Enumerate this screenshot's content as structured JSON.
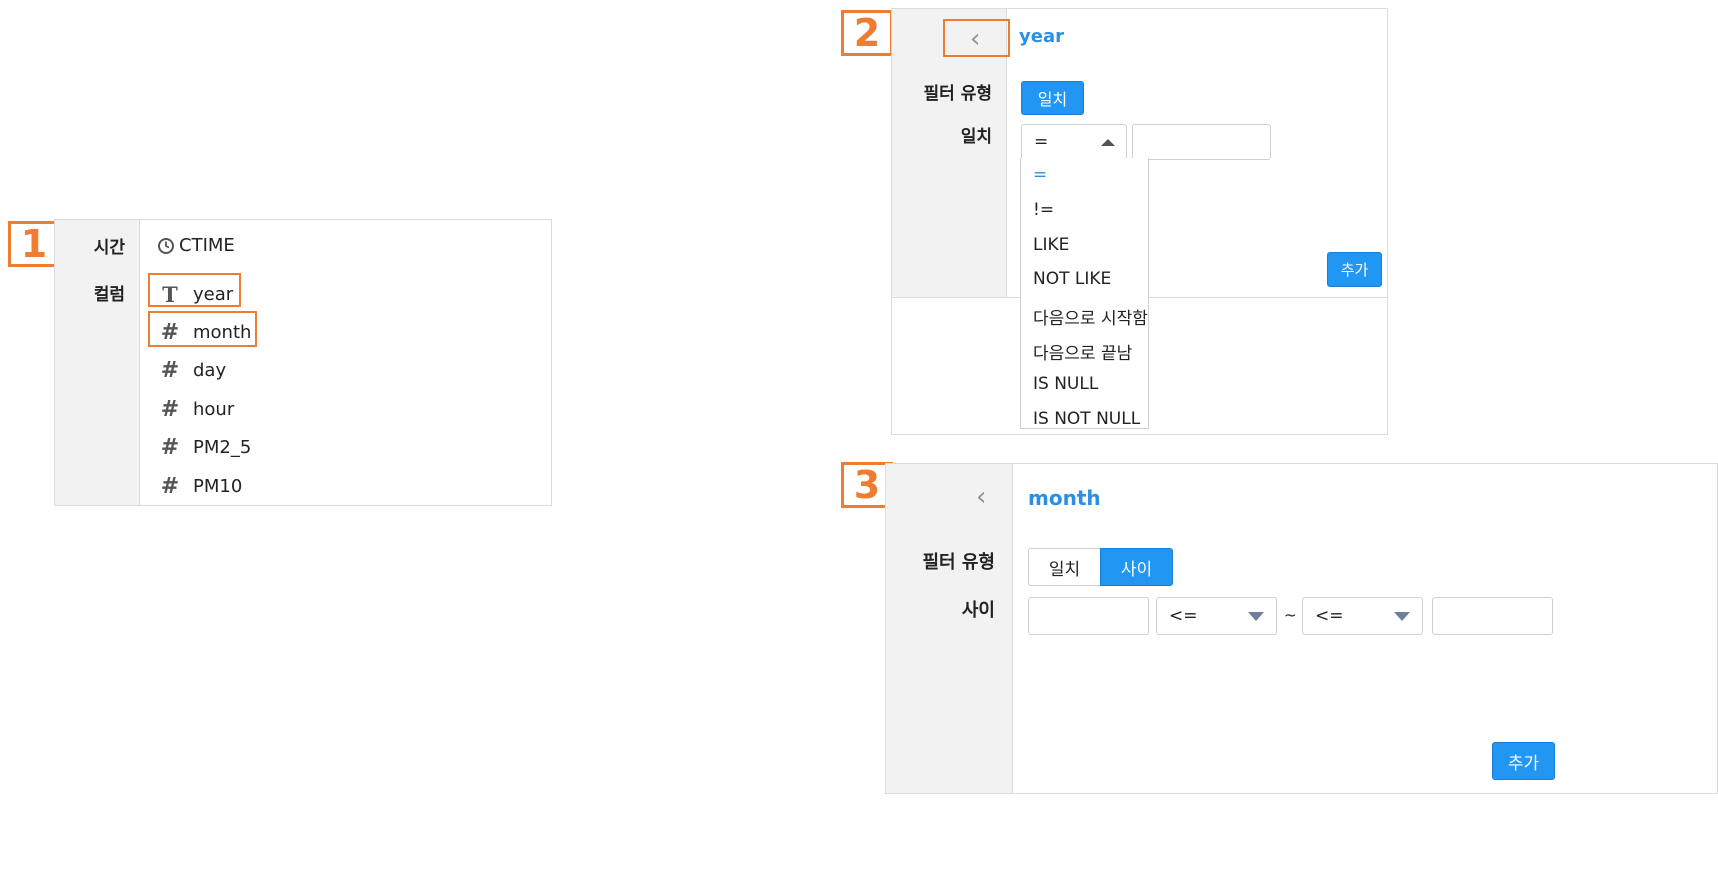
{
  "badges": [
    "1",
    "2",
    "3"
  ],
  "panel1": {
    "time_label": "시간",
    "time_column": "CTIME",
    "column_label": "컬럼",
    "columns": [
      {
        "icon": "text-type-icon",
        "name": "year"
      },
      {
        "icon": "hash-icon",
        "name": "month"
      },
      {
        "icon": "hash-icon",
        "name": "day"
      },
      {
        "icon": "hash-icon",
        "name": "hour"
      },
      {
        "icon": "hash-icon",
        "name": "PM2_5"
      },
      {
        "icon": "hash-icon",
        "name": "PM10"
      }
    ]
  },
  "panel2": {
    "field_name": "year",
    "filter_type_label": "필터 유형",
    "filter_type_button": "일치",
    "match_label": "일치",
    "operator_selected": "=",
    "operator_options": [
      "=",
      "!=",
      "LIKE",
      "NOT LIKE",
      "다음으로 시작함",
      "다음으로 끝남",
      "IS NULL",
      "IS NOT NULL"
    ],
    "add_button": "추가"
  },
  "panel3": {
    "field_name": "month",
    "filter_type_label": "필터 유형",
    "filter_type_options": [
      "일치",
      "사이"
    ],
    "filter_type_selected": "사이",
    "between_label": "사이",
    "left_operator": "<=",
    "tilde": "~",
    "right_operator": "<=",
    "add_button": "추가"
  },
  "colors": {
    "accent": "#2196f3",
    "highlight": "#ee7d2f",
    "label_gray": "#f2f2f2"
  }
}
